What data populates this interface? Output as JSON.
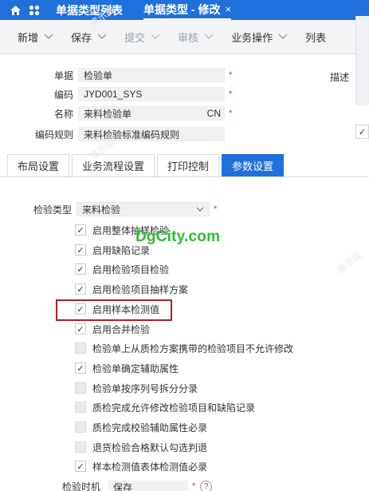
{
  "topbar": {
    "tab_list": "单据类型列表",
    "tab_edit": "单据类型 - 修改",
    "close": "×"
  },
  "toolbar": {
    "items": [
      {
        "label": "新增",
        "disabled": false
      },
      {
        "label": "保存",
        "disabled": false
      },
      {
        "label": "提交",
        "disabled": true
      },
      {
        "label": "审核",
        "disabled": true
      },
      {
        "label": "业务操作",
        "disabled": false
      },
      {
        "label": "列表",
        "disabled": false
      }
    ]
  },
  "form": {
    "doc": {
      "label": "单据",
      "value": "检验单",
      "required": "*"
    },
    "code": {
      "label": "编码",
      "value": "JYD001_SYS",
      "required": "*"
    },
    "name": {
      "label": "名称",
      "value": "来料检验单",
      "lang": "CN",
      "required": "*"
    },
    "rule": {
      "label": "编码规则",
      "value": "来料检验标准编码规则"
    },
    "desc_label": "描述",
    "desc_check": "✓"
  },
  "tabs": [
    {
      "label": "布局设置",
      "active": false
    },
    {
      "label": "业务流程设置",
      "active": false
    },
    {
      "label": "打印控制",
      "active": false
    },
    {
      "label": "参数设置",
      "active": true
    }
  ],
  "params": {
    "type_label": "检验类型",
    "type_value": "来料检验",
    "required": "*",
    "options": [
      {
        "label": "启用整体抽样检验",
        "checked": true
      },
      {
        "label": "启用缺陷记录",
        "checked": true
      },
      {
        "label": "启用检验项目检验",
        "checked": true
      },
      {
        "label": "启用检验项目抽样方案",
        "checked": true
      },
      {
        "label": "启用样本检测值",
        "checked": true
      },
      {
        "label": "启用合并检验",
        "checked": true
      },
      {
        "label": "检验单上从质检方案携带的检验项目不允许修改",
        "checked": false
      },
      {
        "label": "检验单确定辅助属性",
        "checked": true
      },
      {
        "label": "检验单按序列号拆分分录",
        "checked": false
      },
      {
        "label": "质检完成允许修改检验项目和缺陷记录",
        "checked": false
      },
      {
        "label": "质检完成校验辅助属性必录",
        "checked": false
      },
      {
        "label": "退货检验合格默认勾选判退",
        "checked": false
      },
      {
        "label": "样本检测值表体检测值必录",
        "checked": true
      }
    ],
    "partial_label": "检验时机",
    "partial_value": "保存",
    "help": "?"
  },
  "watermark_text": "演示版",
  "site_text": "DgCity.com",
  "check_glyph": "✓",
  "colors": {
    "brand": "#1f6fdd",
    "required": "#e0333a",
    "highlight": "#b11e25",
    "site": "#2cbf36"
  }
}
